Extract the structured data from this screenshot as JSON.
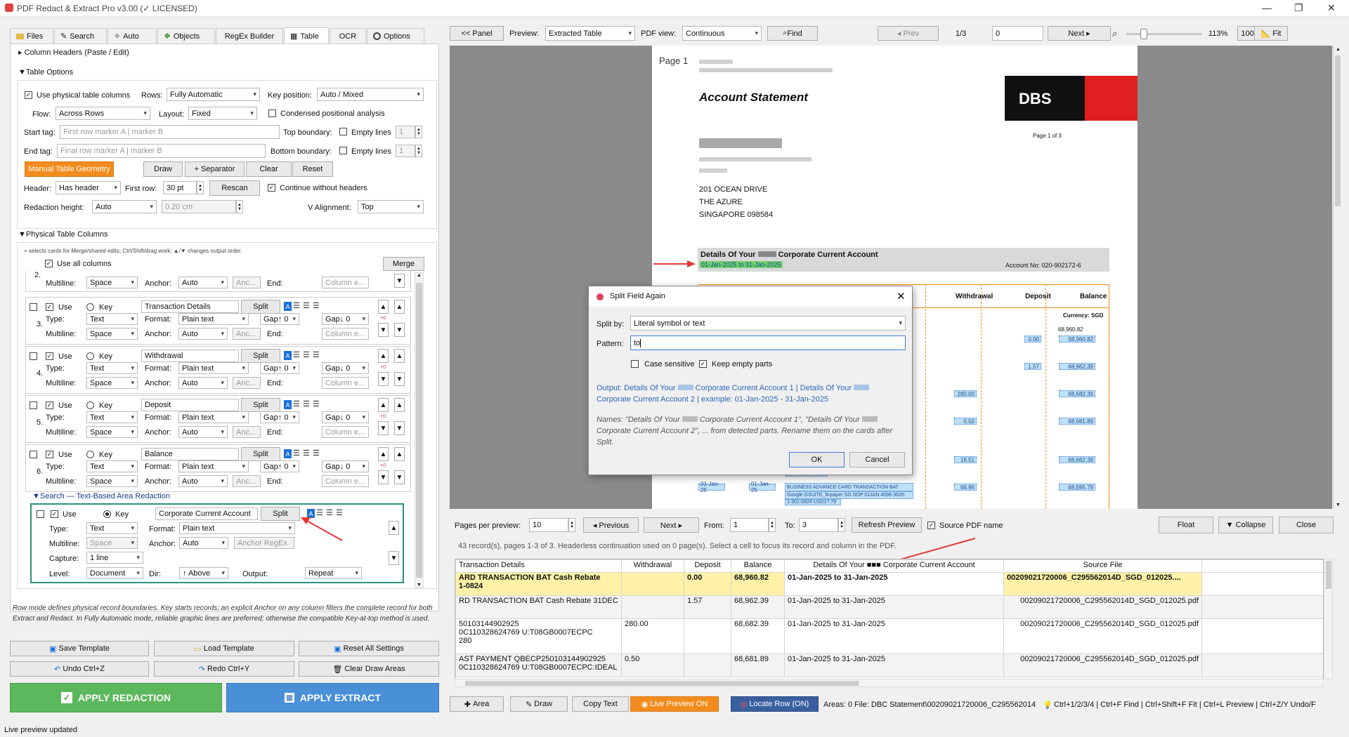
{
  "window": {
    "title": "PDF Redact & Extract Pro v3.00 (",
    "title_badge": "✓",
    "title_licensed": "LICENSED)",
    "minimize": "—",
    "maximize": "❐",
    "close": "✕"
  },
  "tabs": [
    {
      "label": "Files",
      "icon": "folder-icon"
    },
    {
      "label": "Search",
      "icon": "pencil-icon"
    },
    {
      "label": "Auto",
      "icon": "wand-icon"
    },
    {
      "label": "Objects",
      "icon": "objects-icon"
    },
    {
      "label": "RegEx Builder",
      "icon": ""
    },
    {
      "label": "Table",
      "icon": "table-icon"
    },
    {
      "label": "OCR",
      "icon": ""
    },
    {
      "label": "Options",
      "icon": "gear-icon"
    }
  ],
  "col_headers_section": "Column Headers (Paste / Edit)",
  "table_options": {
    "section": "Table Options",
    "use_physical": "Use physical table columns",
    "rows_label": "Rows:",
    "rows_value": "Fully Automatic",
    "key_pos_label": "Key position:",
    "key_pos_value": "Auto / Mixed",
    "flow_label": "Flow:",
    "flow_value": "Across Rows",
    "layout_label": "Layout:",
    "layout_value": "Fixed",
    "condensed": "Condensed positional analysis",
    "start_tag_label": "Start tag:",
    "start_tag_ph": "First row marker A | marker B",
    "top_boundary": "Top boundary:",
    "empty_lines": "Empty lines",
    "empty_val": "1",
    "end_tag_label": "End tag:",
    "end_tag_ph": "Final row marker A | marker B",
    "bottom_boundary": "Bottom boundary:",
    "manual_geo": "Manual Table Geometry",
    "draw": "Draw",
    "separator": "+ Separator",
    "clear": "Clear",
    "reset": "Reset",
    "header_label": "Header:",
    "header_value": "Has header",
    "first_row_label": "First row:",
    "first_row_value": "30 pt",
    "rescan": "Rescan",
    "continue_wo": "Continue without headers",
    "red_height_label": "Redaction height:",
    "red_height_value": "Auto",
    "red_height_cm": "0.20 cm",
    "valign_label": "V Alignment:",
    "valign_value": "Top"
  },
  "phys_cols": {
    "section": "Physical Table Columns",
    "hint": "= selects cards for Merge/shared edits; Ctrl/Shift/drag work; ▲/▼ changes output order.",
    "use_all": "Use all columns",
    "merge": "Merge",
    "partial": {
      "num": "2.",
      "multiline_label": "Multiline:",
      "multiline": "Space",
      "anchor_label": "Anchor:",
      "anchor": "Auto",
      "anc_ph": "Anc...",
      "end_label": "End:",
      "end_ph": "Column e..."
    },
    "cards": [
      {
        "num": "3.",
        "name": "Transaction Details"
      },
      {
        "num": "4.",
        "name": "Withdrawal"
      },
      {
        "num": "5.",
        "name": "Deposit"
      },
      {
        "num": "6.",
        "name": "Balance"
      }
    ],
    "card_labels": {
      "use": "Use",
      "key": "Key",
      "split": "Split",
      "type_label": "Type:",
      "type": "Text",
      "format_label": "Format:",
      "format": "Plain text",
      "gap1": "Gap↑ 0",
      "gap2": "Gap↓ 0",
      "multiline_label": "Multiline:",
      "multiline": "Space",
      "anchor_label": "Anchor:",
      "anchor": "Auto",
      "anc_ph": "Anc...",
      "end_label": "End:",
      "end_ph": "Column e...",
      "plus0": "+0"
    }
  },
  "search_area": {
    "section": "Search — Text-Based Area Redaction",
    "use": "Use",
    "key": "Key",
    "name": "Corporate Current Account",
    "split": "Split",
    "type_label": "Type:",
    "type": "Text",
    "format_label": "Format:",
    "format": "Plain text",
    "multiline_label": "Multiline:",
    "multiline": "Space",
    "anchor_label": "Anchor:",
    "anchor": "Auto",
    "anchor_ph": "Anchor RegEx",
    "capture_label": "Capture:",
    "capture": "1 line",
    "level_label": "Level:",
    "level": "Document",
    "dir_label": "Dir:",
    "dir": "↑ Above",
    "output_label": "Output:",
    "output": "Repeat"
  },
  "note": "Row mode defines physical record boundaries. Key starts records; an explicit Anchor on any column filters the complete record for both Extract and Redact. In Fully Automatic mode, reliable graphic lines are preferred; otherwise the compatible Key-at-top method is used.",
  "bottom_buttons": {
    "save": "Save Template",
    "load": "Load Template",
    "reset_all": "Reset All Settings",
    "undo": "Undo  Ctrl+Z",
    "redo": "Redo  Ctrl+Y",
    "clear_draw": "Clear Draw Areas",
    "apply_red": "APPLY REDACTION",
    "apply_ext": "APPLY EXTRACT"
  },
  "status": "Live preview updated",
  "toolbar": {
    "panel": "<< Panel",
    "preview_label": "Preview:",
    "preview_value": "Extracted Table",
    "pdfview_label": "PDF view:",
    "pdfview_value": "Continuous",
    "find": "Find",
    "prev": "◂ Prev",
    "page": "1/3",
    "page_input": "0",
    "next": "Next ▸",
    "zoom": "113%",
    "pct100": "100%",
    "fit": "Fit"
  },
  "doc": {
    "page_label": "Page 1",
    "title": "Account Statement",
    "logo": "DBS",
    "page_of": "Page    1     of     3",
    "addr1": "201 OCEAN DRIVE",
    "addr2": "THE AZURE",
    "addr3": "SINGAPORE  098584",
    "details_title_a": "Details Of Your",
    "details_title_b": "Corporate Current Account",
    "date_range": "01-Jan-2025  to  31-Jan-2025",
    "acct_no": "Account No: 020-902172-6",
    "col_withdrawal": "Withdrawal",
    "col_deposit": "Deposit",
    "col_balance": "Balance",
    "currency": "Currency: SGD",
    "line1": "BUSINESS ADVANCE CARD TRANSACTION BAT",
    "line2": "Google GSUITE_finpaper SG SGP 01JAN 4096-3626-",
    "line3": "1-301-0824 USD17.79",
    "vals": {
      "v6896082": "68,960.82",
      "d000": "0.00",
      "b6896082": "68,960.82",
      "d157": "1.57",
      "b6896239": "68,962.39",
      "w28000": "280.00",
      "b6868239": "68,682.39",
      "w050": "0.50",
      "b6868189": "68,681.89",
      "w1951": "19.51",
      "b6866238": "68,662.38",
      "w6696": "66.96",
      "b6859579": "68,595.79",
      "dt1": "01-Jan-25",
      "dt2": "01-Jan-25"
    }
  },
  "dialog": {
    "title": "Split Field Again",
    "split_by_label": "Split by:",
    "split_by": "Literal symbol or text",
    "pattern_label": "Pattern:",
    "pattern": "to",
    "case_sensitive": "Case sensitive",
    "keep_empty": "Keep empty parts",
    "output_a": "Output: Details Of Your",
    "output_b": "Corporate Current Account 1 | Details Of Your",
    "output_c": "Corporate Current Account 2 | example: 01-Jan-2025 - 31-Jan-2025",
    "names_a": "Names: \"Details Of Your",
    "names_b": "Corporate Current Account 1\", \"Details Of Your",
    "names_c": "Corporate Current Account 2\", ... from detected parts. Rename them on the cards after Split.",
    "ok": "OK",
    "cancel": "Cancel"
  },
  "preview_controls": {
    "ppp_label": "Pages per preview:",
    "ppp": "10",
    "previous": "◂ Previous",
    "next": "Next ▸",
    "from_label": "From:",
    "from": "1",
    "to_label": "To:",
    "to": "3",
    "refresh": "Refresh Preview",
    "source_pdf": "Source PDF name",
    "float": "Float",
    "collapse": "▼ Collapse",
    "close": "Close"
  },
  "records_info": "43 record(s), pages 1-3 of 3. Headerless continuation used on 0 page(s). Select a cell to focus its record and column in the PDF.",
  "grid": {
    "headers": [
      "Transaction Details",
      "Withdrawal",
      "Deposit",
      "Balance",
      "Details Of Your ■■■ Corporate Current Account",
      "Source File"
    ],
    "rows": [
      {
        "c0": "ARD TRANSACTION BAT Cash Rebate",
        "c0b": "1-0824",
        "c1": "",
        "c2": "0.00",
        "c3": "68,960.82",
        "c4": "01-Jan-2025 to 31-Jan-2025",
        "c5": "00209021720006_C295562014D_SGD_012025...."
      },
      {
        "c0": "RD TRANSACTION BAT Cash Rebate 31DEC",
        "c0b": "",
        "c1": "",
        "c2": "1.57",
        "c3": "68,962.39",
        "c4": "01-Jan-2025 to 31-Jan-2025",
        "c5": "00209021720006_C295562014D_SGD_012025.pdf"
      },
      {
        "c0": "50103144902925",
        "c0b": "0C110328624769 U:T08GB0007ECPC",
        "c0c": "280",
        "c1": "280.00",
        "c2": "",
        "c3": "68,682.39",
        "c4": "01-Jan-2025 to 31-Jan-2025",
        "c5": "00209021720006_C295562014D_SGD_012025.pdf"
      },
      {
        "c0": "AST PAYMENT QBECP250103144902925",
        "c0b": "0C110328624769 U:T08GB0007ECPC:IDEAL",
        "c1": "0.50",
        "c2": "",
        "c3": "68,681.89",
        "c4": "01-Jan-2025 to 31-Jan-2025",
        "c5": "00209021720006_C295562014D_SGD_012025.pdf"
      }
    ]
  },
  "bottom_toolbar": {
    "area": "Area",
    "draw": "Draw",
    "copy": "Copy Text",
    "live": "Live Preview ON",
    "locate": "Locate Row (ON)",
    "areas": "Areas: 0  File: DBC Statement\\00209021720006_C295562014",
    "hints": "Ctrl+1/2/3/4 | Ctrl+F Find | Ctrl+Shift+F Fit | Ctrl+L Preview | Ctrl+Z/Y Undo/F"
  },
  "colors": {
    "accent_orange": "#f28c1e",
    "green": "#5cb85c",
    "blue": "#4a90d9",
    "highlight_yellow": "#fff2a8",
    "red_arrow": "#e53935"
  }
}
